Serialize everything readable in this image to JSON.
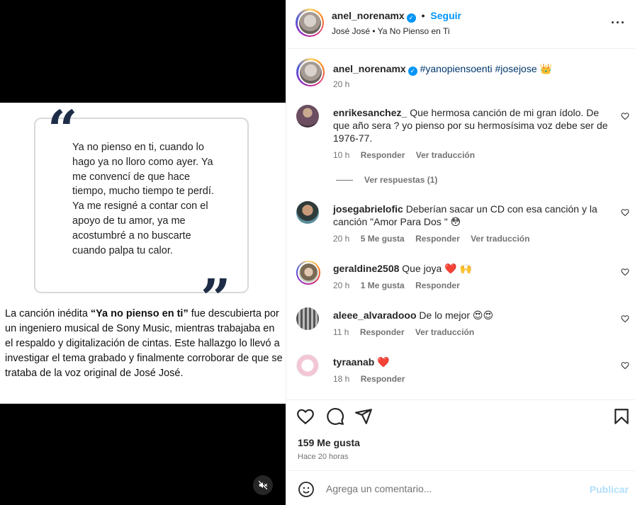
{
  "media": {
    "quote_open": "“",
    "quote_close": "”",
    "quote_text": "Ya no pienso en ti, cuando lo hago ya no lloro como ayer. Ya me convencí de que hace tiempo, mucho tiempo te perdí. Ya me resigné a contar con el apoyo de tu amor, ya me acostumbré a no buscarte cuando palpa tu calor.",
    "caption_prefix": "La canción inédita ",
    "caption_bold": "“Ya no pienso en ti”",
    "caption_suffix": " fue descubierta por un ingeniero musical de Sony Music, mientras trabajaba en el respaldo y digitalización de cintas. Este hallazgo lo llevó a investigar el tema grabado y finalmente corroborar de que se trataba de la voz original de José José.",
    "mute_icon": "speaker-muted-icon"
  },
  "header": {
    "username": "anel_norenamx",
    "verified_mark": "✓",
    "dot": "•",
    "follow_label": "Seguir",
    "audio": "José José • Ya No Pienso en Ti",
    "more": "···"
  },
  "caption_comment": {
    "username": "anel_norenamx",
    "text": "#yanopiensoenti #josejose 👑",
    "time": "20 h"
  },
  "comments": [
    {
      "username": "enrikesanchez_",
      "text": "Que hermosa canción de mi gran ídolo. De que año sera ? yo pienso por su hermosísima voz debe ser de 1976-77.",
      "time": "10 h",
      "likes": "",
      "reply": "Responder",
      "translate": "Ver traducción"
    },
    {
      "username": "josegabrielofic",
      "text": "Deberían sacar un CD con esa canción y la canción \"Amor Para Dos \" 😳",
      "time": "20 h",
      "likes": "5 Me gusta",
      "reply": "Responder",
      "translate": "Ver traducción"
    },
    {
      "username": "geraldine2508",
      "text": "Que joya ❤️ 🙌",
      "time": "20 h",
      "likes": "1 Me gusta",
      "reply": "Responder",
      "translate": ""
    },
    {
      "username": "aleee_alvaradooo",
      "text": "De lo mejor 😍😍",
      "time": "11 h",
      "likes": "",
      "reply": "Responder",
      "translate": "Ver traducción"
    },
    {
      "username": "tyraanab",
      "text": "❤️",
      "time": "18 h",
      "likes": "",
      "reply": "Responder",
      "translate": ""
    }
  ],
  "view_replies": "Ver respuestas (1)",
  "actions": {
    "likes": "159 Me gusta",
    "time_ago": "Hace 20 horas"
  },
  "composer": {
    "placeholder": "Agrega un comentario...",
    "publish": "Publicar"
  },
  "colors": {
    "accent": "#0095f6",
    "hashtag": "#00376b",
    "quote_mark": "#1e2d47",
    "publish_disabled": "#b2dffc"
  }
}
